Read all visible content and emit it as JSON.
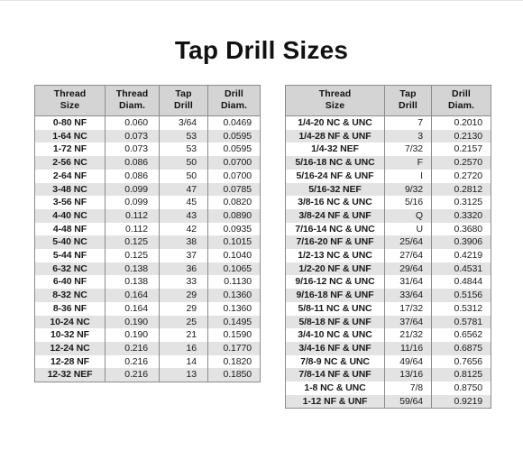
{
  "page": {
    "title": "Tap Drill Sizes"
  },
  "left_table": {
    "name": "tap-drill-sizes-machine-screw",
    "headers": [
      "Thread Size",
      "Thread Diam.",
      "Tap Drill",
      "Drill Diam."
    ],
    "header_lines": [
      [
        "Thread",
        "Size"
      ],
      [
        "Thread",
        "Diam."
      ],
      [
        "Tap",
        "Drill"
      ],
      [
        "Drill",
        "Diam."
      ]
    ],
    "rows": [
      [
        "0-80 NF",
        "0.060",
        "3/64",
        "0.0469"
      ],
      [
        "1-64 NC",
        "0.073",
        "53",
        "0.0595"
      ],
      [
        "1-72 NF",
        "0.073",
        "53",
        "0.0595"
      ],
      [
        "2-56 NC",
        "0.086",
        "50",
        "0.0700"
      ],
      [
        "2-64 NF",
        "0.086",
        "50",
        "0.0700"
      ],
      [
        "3-48 NC",
        "0.099",
        "47",
        "0.0785"
      ],
      [
        "3-56 NF",
        "0.099",
        "45",
        "0.0820"
      ],
      [
        "4-40 NC",
        "0.112",
        "43",
        "0.0890"
      ],
      [
        "4-48 NF",
        "0.112",
        "42",
        "0.0935"
      ],
      [
        "5-40 NC",
        "0.125",
        "38",
        "0.1015"
      ],
      [
        "5-44 NF",
        "0.125",
        "37",
        "0.1040"
      ],
      [
        "6-32 NC",
        "0.138",
        "36",
        "0.1065"
      ],
      [
        "6-40 NF",
        "0.138",
        "33",
        "0.1130"
      ],
      [
        "8-32 NC",
        "0.164",
        "29",
        "0.1360"
      ],
      [
        "8-36 NF",
        "0.164",
        "29",
        "0.1360"
      ],
      [
        "10-24 NC",
        "0.190",
        "25",
        "0.1495"
      ],
      [
        "10-32 NF",
        "0.190",
        "21",
        "0.1590"
      ],
      [
        "12-24 NC",
        "0.216",
        "16",
        "0.1770"
      ],
      [
        "12-28 NF",
        "0.216",
        "14",
        "0.1820"
      ],
      [
        "12-32 NEF",
        "0.216",
        "13",
        "0.1850"
      ]
    ]
  },
  "right_table": {
    "name": "tap-drill-sizes-fractional",
    "headers": [
      "Thread Size",
      "Tap Drill",
      "Drill Diam."
    ],
    "header_lines": [
      [
        "Thread",
        "Size"
      ],
      [
        "Tap",
        "Drill"
      ],
      [
        "Drill",
        "Diam."
      ]
    ],
    "rows": [
      [
        "1/4-20 NC & UNC",
        "7",
        "0.2010"
      ],
      [
        "1/4-28 NF & UNF",
        "3",
        "0.2130"
      ],
      [
        "1/4-32 NEF",
        "7/32",
        "0.2157"
      ],
      [
        "5/16-18 NC & UNC",
        "F",
        "0.2570"
      ],
      [
        "5/16-24 NF & UNF",
        "I",
        "0.2720"
      ],
      [
        "5/16-32 NEF",
        "9/32",
        "0.2812"
      ],
      [
        "3/8-16 NC & UNC",
        "5/16",
        "0.3125"
      ],
      [
        "3/8-24 NF & UNF",
        "Q",
        "0.3320"
      ],
      [
        "7/16-14 NC & UNC",
        "U",
        "0.3680"
      ],
      [
        "7/16-20 NF & UNF",
        "25/64",
        "0.3906"
      ],
      [
        "1/2-13 NC & UNC",
        "27/64",
        "0.4219"
      ],
      [
        "1/2-20 NF & UNF",
        "29/64",
        "0.4531"
      ],
      [
        "9/16-12 NC & UNC",
        "31/64",
        "0.4844"
      ],
      [
        "9/16-18 NF & UNF",
        "33/64",
        "0.5156"
      ],
      [
        "5/8-11 NC & UNC",
        "17/32",
        "0.5312"
      ],
      [
        "5/8-18 NF & UNF",
        "37/64",
        "0.5781"
      ],
      [
        "3/4-10 NC & UNC",
        "21/32",
        "0.6562"
      ],
      [
        "3/4-16 NF & UNF",
        "11/16",
        "0.6875"
      ],
      [
        "7/8-9 NC & UNC",
        "49/64",
        "0.7656"
      ],
      [
        "7/8-14 NF & UNF",
        "13/16",
        "0.8125"
      ],
      [
        "1-8 NC & UNC",
        "7/8",
        "0.8750"
      ],
      [
        "1-12 NF & UNF",
        "59/64",
        "0.9219"
      ]
    ]
  },
  "colors": {
    "header_bg": "#d4d4d4",
    "stripe_bg": "#e3e3e3",
    "row_bg": "#ffffff",
    "border": "#8c8c8c",
    "text": "#111111",
    "page_bg": "#ffffff"
  }
}
